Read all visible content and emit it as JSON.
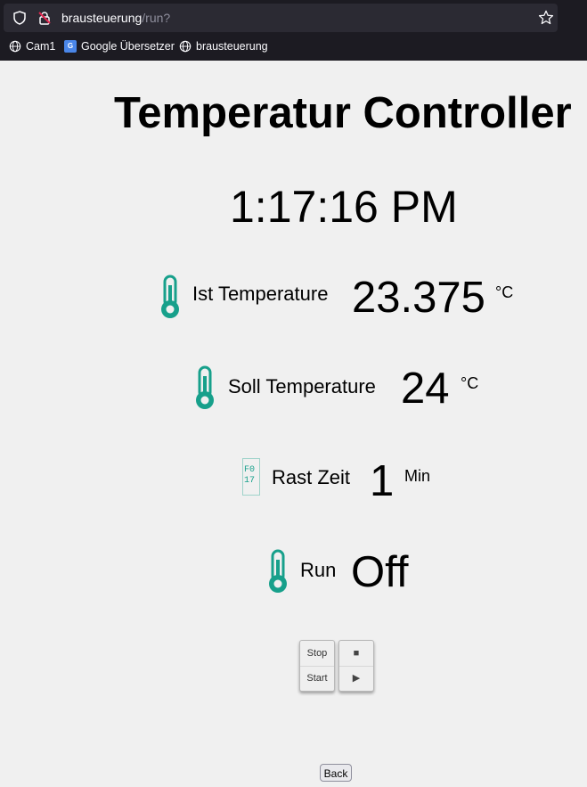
{
  "browser": {
    "url_host": "brausteuerung",
    "url_path": "/run?",
    "bookmarks": [
      "Cam1",
      "Google Übersetzer",
      "brausteuerung"
    ],
    "google_translate_glyph": "G"
  },
  "page": {
    "title": "Temperatur Controller",
    "clock": "1:17:16 PM",
    "ist": {
      "label": "Ist Temperature",
      "value": "23.375",
      "unit": "°C"
    },
    "soll": {
      "label": "Soll Temperature",
      "value": "24",
      "unit": "°C"
    },
    "rast": {
      "label": "Rast Zeit",
      "value": "1",
      "unit": "Min"
    },
    "run": {
      "label": "Run",
      "value": "Off"
    },
    "buttons": {
      "stop_label": "Stop",
      "start_label": "Start",
      "stop_symbol": "■",
      "start_symbol": "▶"
    },
    "back_label": "Back"
  },
  "colors": {
    "icon_teal": "#17a08b"
  }
}
